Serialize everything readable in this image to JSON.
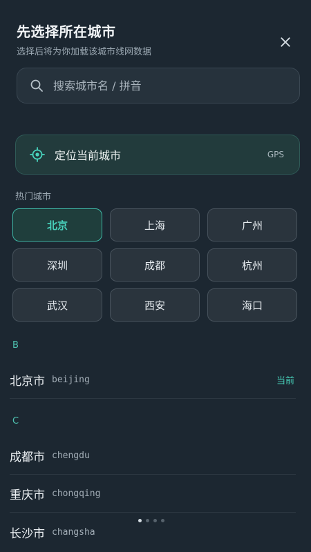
{
  "header": {
    "title": "先选择所在城市",
    "subtitle": "选择后将为你加载该城市线网数据"
  },
  "search": {
    "placeholder": "搜索城市名 / 拼音",
    "value": ""
  },
  "locate": {
    "label": "定位当前城市",
    "tag": "GPS"
  },
  "hot": {
    "label": "热门城市",
    "cities": [
      "北京",
      "上海",
      "广州",
      "深圳",
      "成都",
      "杭州",
      "武汉",
      "西安",
      "海口"
    ],
    "selected": "北京"
  },
  "list": {
    "groups": [
      {
        "letter": "B",
        "rows": [
          {
            "name": "北京市",
            "pinyin": "beijing",
            "badge": "当前"
          }
        ]
      },
      {
        "letter": "C",
        "rows": [
          {
            "name": "成都市",
            "pinyin": "chengdu"
          },
          {
            "name": "重庆市",
            "pinyin": "chongqing"
          },
          {
            "name": "长沙市",
            "pinyin": "changsha"
          }
        ]
      }
    ]
  },
  "pager": {
    "total": 4,
    "active": 1
  },
  "colors": {
    "background": "#1c2731",
    "accent": "#48d3bd",
    "chip": "#2a343d",
    "locate_bg": "#223b3c"
  },
  "icons": {
    "close": "close-icon",
    "search": "search-icon",
    "locate": "crosshair-icon"
  }
}
